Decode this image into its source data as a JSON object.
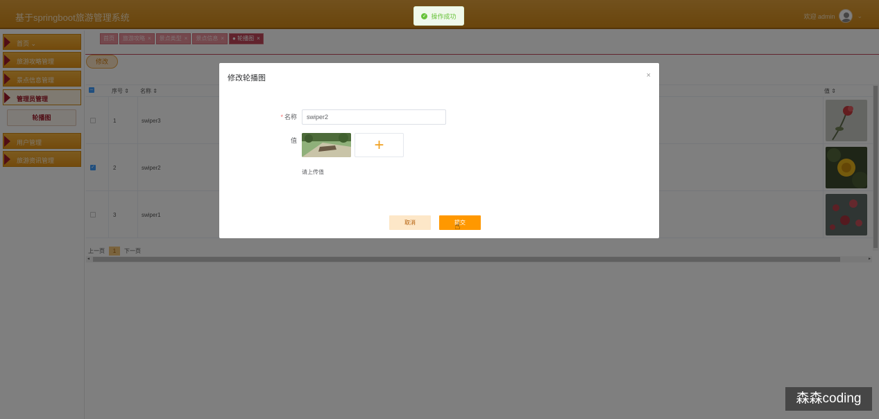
{
  "header": {
    "app_title": "基于springboot旅游管理系统",
    "welcome": "欢迎 admin",
    "chevron": "⌄"
  },
  "toast": {
    "text": "操作成功",
    "icon": "check-circle-icon",
    "color": "#67c23a"
  },
  "sidebar": {
    "items": [
      {
        "label": "首页 ⌄"
      },
      {
        "label": "旅游攻略管理"
      },
      {
        "label": "景点信息管理"
      },
      {
        "label": "管理员管理"
      },
      {
        "label": "用户管理"
      },
      {
        "label": "旅游资讯管理"
      }
    ],
    "submenu_label": "轮播图"
  },
  "tabs": [
    {
      "label": "首页",
      "close": ""
    },
    {
      "label": "旅游攻略",
      "close": "×"
    },
    {
      "label": "景点类型",
      "close": "×"
    },
    {
      "label": "景点信息",
      "close": "×"
    },
    {
      "label": "● 轮播图",
      "close": "×"
    }
  ],
  "toolbar": {
    "edit_label": "修改"
  },
  "table": {
    "columns": {
      "index": "序号 ⇕",
      "name": "名称 ⇕",
      "value": "值 ⇕"
    },
    "rows": [
      {
        "index": "1",
        "name": "swiper3",
        "checked": false
      },
      {
        "index": "2",
        "name": "swiper2",
        "checked": true
      },
      {
        "index": "3",
        "name": "swiper1",
        "checked": false
      }
    ]
  },
  "pager": {
    "prev": "上一页",
    "page": "1",
    "next": "下一页"
  },
  "modal": {
    "title": "修改轮播图",
    "close": "×",
    "name_label": "名称",
    "required_mark": "*",
    "name_value": "swiper2",
    "value_label": "值",
    "upload_plus": "+",
    "hint": "请上传值",
    "cancel_label": "取消",
    "submit_label": "提交"
  },
  "watermark": "森森coding",
  "colors": {
    "accent": "#ff9800",
    "header": "#d99223",
    "sidebar_marker": "#a11b2a",
    "tab_active": "#c2475a"
  }
}
